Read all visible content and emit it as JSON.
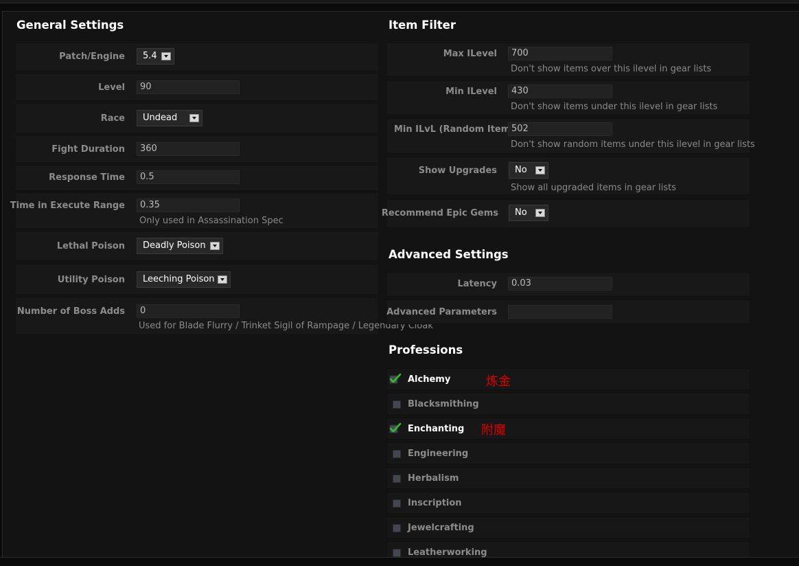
{
  "general": {
    "heading": "General Settings",
    "patch": {
      "label": "Patch/Engine",
      "value": "5.4"
    },
    "level": {
      "label": "Level",
      "value": "90"
    },
    "race": {
      "label": "Race",
      "value": "Undead"
    },
    "fight_duration": {
      "label": "Fight Duration",
      "value": "360"
    },
    "response_time": {
      "label": "Response Time",
      "value": "0.5"
    },
    "execute_range": {
      "label": "Time in Execute Range",
      "value": "0.35",
      "help": "Only used in Assassination Spec"
    },
    "lethal_poison": {
      "label": "Lethal Poison",
      "value": "Deadly Poison"
    },
    "utility_poison": {
      "label": "Utility Poison",
      "value": "Leeching Poison"
    },
    "boss_adds": {
      "label": "Number of Boss Adds",
      "value": "0",
      "help": "Used for Blade Flurry / Trinket Sigil of Rampage / Legendary Cloak"
    }
  },
  "item_filter": {
    "heading": "Item Filter",
    "max_ilevel": {
      "label": "Max ILevel",
      "value": "700",
      "help": "Don't show items over this ilevel in gear lists"
    },
    "min_ilevel": {
      "label": "Min ILevel",
      "value": "430",
      "help": "Don't show items under this ilevel in gear lists"
    },
    "min_random": {
      "label": "Min ILvL (Random Items)",
      "value": "502",
      "help": "Don't show random items under this ilevel in gear lists"
    },
    "show_upgrades": {
      "label": "Show Upgrades",
      "value": "No",
      "help": "Show all upgraded items in gear lists"
    },
    "epic_gems": {
      "label": "Recommend Epic Gems",
      "value": "No"
    }
  },
  "advanced": {
    "heading": "Advanced Settings",
    "latency": {
      "label": "Latency",
      "value": "0.03"
    },
    "params": {
      "label": "Advanced Parameters",
      "value": ""
    }
  },
  "professions": {
    "heading": "Professions",
    "items": [
      {
        "label": "Alchemy",
        "checked": true,
        "annotation": "炼金"
      },
      {
        "label": "Blacksmithing",
        "checked": false
      },
      {
        "label": "Enchanting",
        "checked": true,
        "annotation": "附魔"
      },
      {
        "label": "Engineering",
        "checked": false
      },
      {
        "label": "Herbalism",
        "checked": false
      },
      {
        "label": "Inscription",
        "checked": false
      },
      {
        "label": "Jewelcrafting",
        "checked": false
      },
      {
        "label": "Leatherworking",
        "checked": false
      }
    ]
  },
  "colors": {
    "background": "#131313",
    "row": "#181818",
    "label": "#8c8c8c",
    "heading": "#ffffff",
    "annotation": "#e00000",
    "check": "#2fbf2f"
  }
}
